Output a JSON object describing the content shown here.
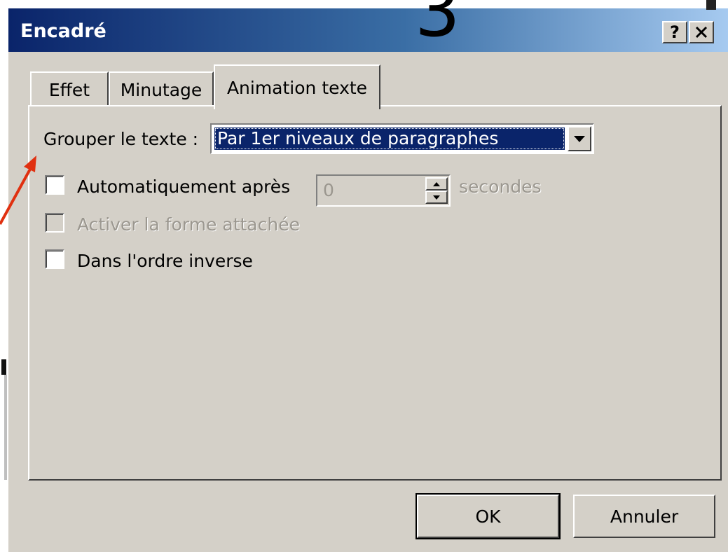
{
  "overlay": {
    "slide_number": "3"
  },
  "dialog": {
    "title": "Encadré",
    "help_label": "?",
    "close_label": "✕"
  },
  "tabs": [
    {
      "label": "Effet",
      "active": false
    },
    {
      "label": "Minutage",
      "active": false
    },
    {
      "label": "Animation texte",
      "active": true
    }
  ],
  "group": {
    "label": "Grouper le texte :",
    "selected": "Par 1er niveaux de paragraphes"
  },
  "options": {
    "auto_label": "Automatiquement après",
    "auto_value": "0",
    "auto_unit": "secondes",
    "attach_label": "Activer la forme attachée",
    "reverse_label": "Dans l'ordre inverse"
  },
  "buttons": {
    "ok": "OK",
    "cancel": "Annuler"
  },
  "annotation": {
    "arrow_color": "#e03010"
  }
}
